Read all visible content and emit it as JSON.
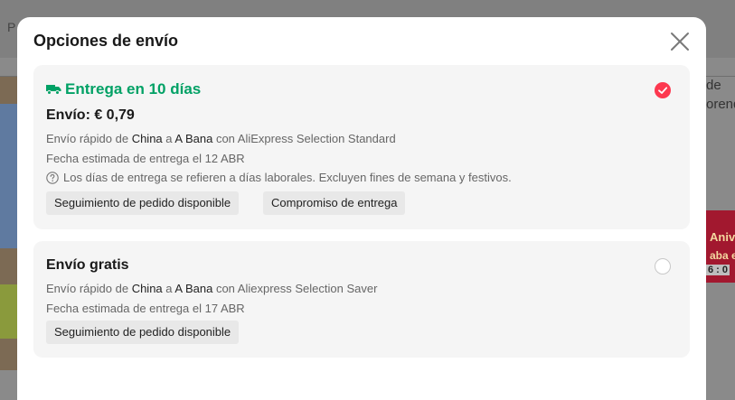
{
  "background": {
    "topbar_text": "P",
    "right_text_1": "de",
    "right_text_2": "orend",
    "promo_line_1": "Aniv",
    "promo_line_2": "aba e",
    "promo_line_3": "6 : 0"
  },
  "modal": {
    "title": "Opciones de envío"
  },
  "options": [
    {
      "eta": "Entrega en 10 días",
      "price": "Envío: € 0,79",
      "route_prefix": "Envío rápido de ",
      "origin": "China",
      "route_mid": " a ",
      "destination": "A Bana",
      "route_suffix": " con AliExpress Selection Standard",
      "estimate": "Fecha estimada de entrega el 12 ABR",
      "note": "Los días de entrega se refieren a días laborales. Excluyen fines de semana y festivos.",
      "tags": [
        "Seguimiento de pedido disponible",
        "Compromiso de entrega"
      ],
      "selected": true
    },
    {
      "price": "Envío gratis",
      "route_prefix": "Envío rápido de ",
      "origin": "China",
      "route_mid": " a ",
      "destination": "A Bana",
      "route_suffix": " con Aliexpress Selection Saver",
      "estimate": "Fecha estimada de entrega el 17 ABR",
      "tags": [
        "Seguimiento de pedido disponible"
      ],
      "selected": false
    }
  ],
  "colors": {
    "accent_green": "#00a165",
    "selected_red": "#fd384f"
  },
  "icons": {
    "close": "close-icon",
    "truck": "truck-icon",
    "help": "help-icon",
    "check": "check-icon"
  }
}
